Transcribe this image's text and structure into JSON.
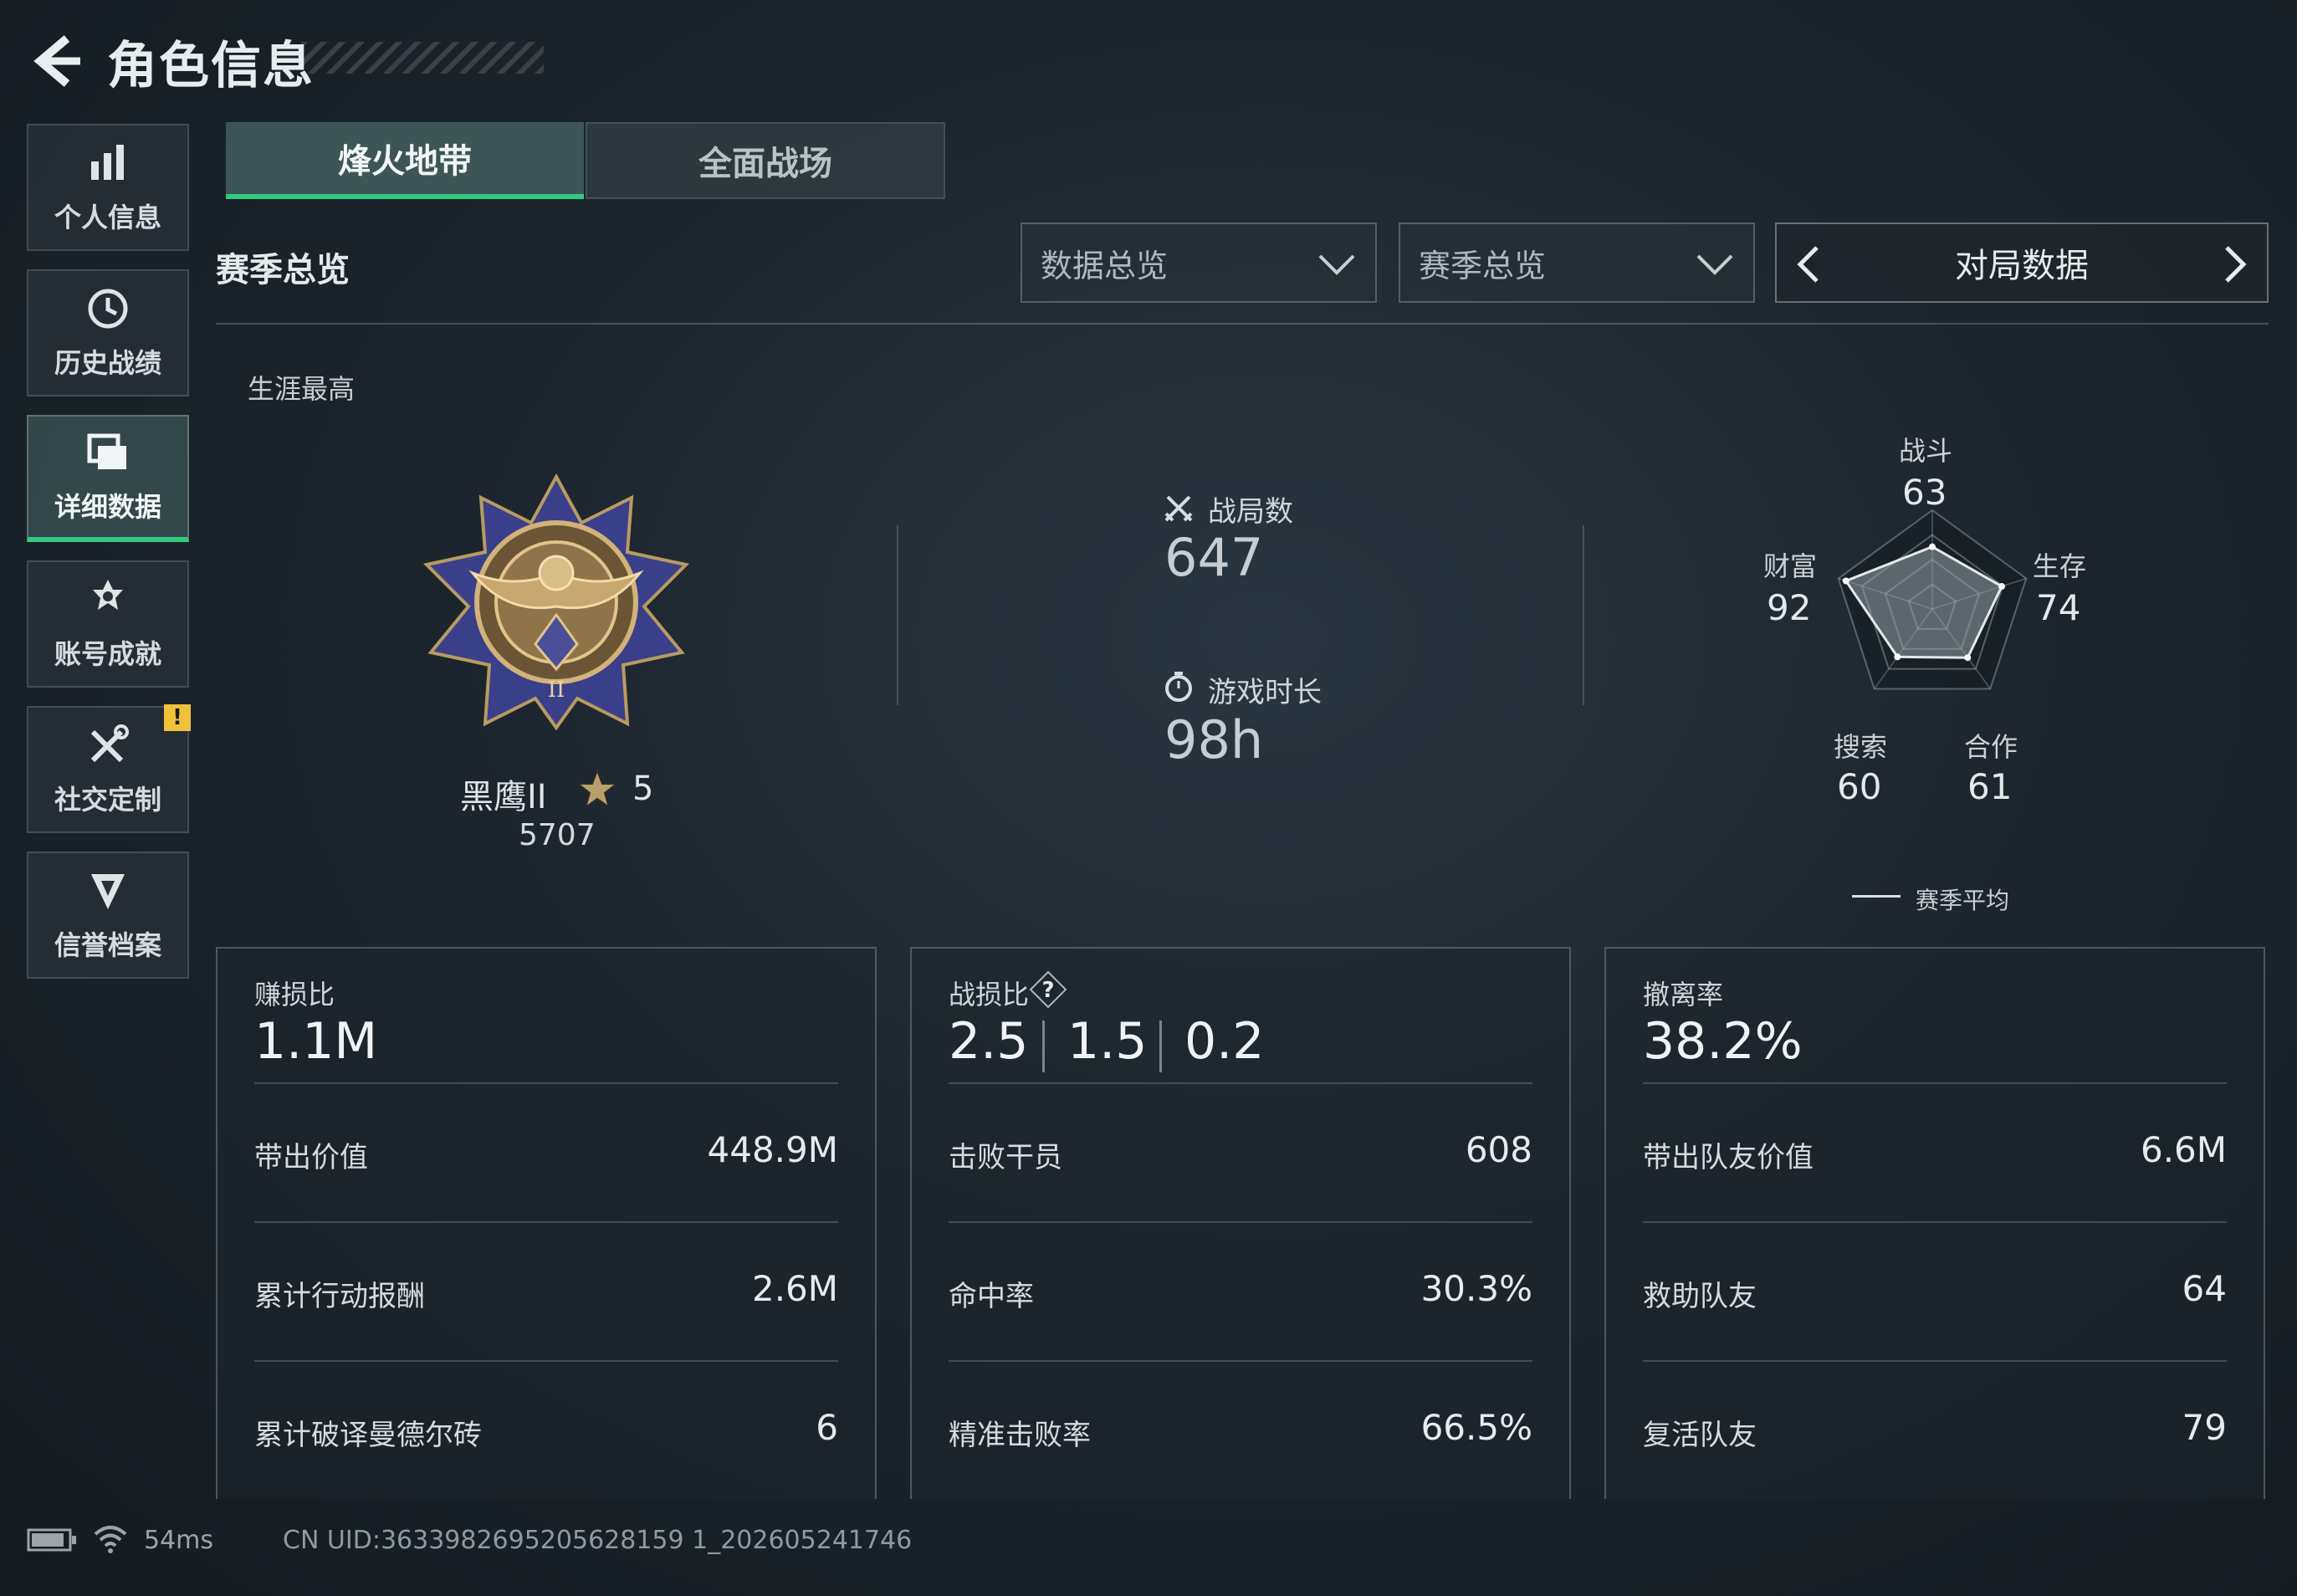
{
  "header": {
    "title": "角色信息"
  },
  "sidebar": {
    "items": [
      {
        "label": "个人信息",
        "icon": "bar-chart-icon"
      },
      {
        "label": "历史战绩",
        "icon": "history-clock-icon"
      },
      {
        "label": "详细数据",
        "icon": "cards-icon",
        "active": true
      },
      {
        "label": "账号成就",
        "icon": "achievement-icon"
      },
      {
        "label": "社交定制",
        "icon": "tools-icon",
        "badge": "!"
      },
      {
        "label": "信誉档案",
        "icon": "reputation-icon"
      }
    ]
  },
  "tabs": [
    {
      "label": "烽火地带",
      "active": true
    },
    {
      "label": "全面战场",
      "active": false
    }
  ],
  "section": {
    "title": "赛季总览",
    "dropdown_1": "数据总览",
    "dropdown_2": "赛季总览",
    "switcher_label": "对局数据"
  },
  "career": {
    "label": "生涯最高",
    "rank_name": "黑鹰II",
    "stars": "5",
    "score": "5707"
  },
  "stats": {
    "matches_label": "战局数",
    "matches_value": "647",
    "playtime_label": "游戏时长",
    "playtime_value": "98h"
  },
  "radar": {
    "axes": [
      {
        "label": "战斗",
        "value": "63"
      },
      {
        "label": "生存",
        "value": "74"
      },
      {
        "label": "合作",
        "value": "61"
      },
      {
        "label": "搜索",
        "value": "60"
      },
      {
        "label": "财富",
        "value": "92"
      }
    ],
    "levels": [
      0.63,
      0.74,
      0.61,
      0.6,
      0.92
    ],
    "legend": "赛季平均"
  },
  "cards": [
    {
      "title": "赚损比",
      "big_value": "1.1M",
      "rows": [
        {
          "label": "带出价值",
          "value": "448.9M"
        },
        {
          "label": "累计行动报酬",
          "value": "2.6M"
        },
        {
          "label": "累计破译曼德尔砖",
          "value": "6"
        }
      ]
    },
    {
      "title": "战损比",
      "big_values": [
        "2.5",
        "1.5",
        "0.2"
      ],
      "rows": [
        {
          "label": "击败干员",
          "value": "608"
        },
        {
          "label": "命中率",
          "value": "30.3%"
        },
        {
          "label": "精准击败率",
          "value": "66.5%"
        }
      ]
    },
    {
      "title": "撤离率",
      "big_value": "38.2%",
      "rows": [
        {
          "label": "带出队友价值",
          "value": "6.6M"
        },
        {
          "label": "救助队友",
          "value": "64"
        },
        {
          "label": "复活队友",
          "value": "79"
        }
      ]
    }
  ],
  "footer": {
    "ping": "54ms",
    "uid": "CN UID:3633982695205628159 1_202605241746"
  },
  "colors": {
    "accent": "#2fcb7f",
    "warning": "#f0c23a"
  }
}
